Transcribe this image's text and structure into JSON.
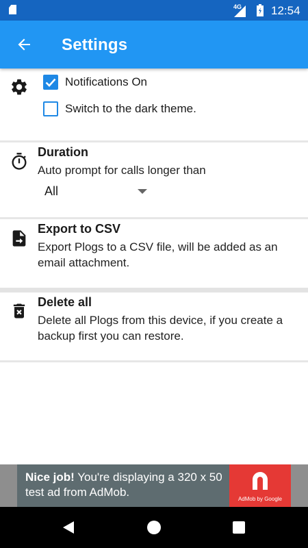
{
  "status_bar": {
    "network": "4G",
    "time": "12:54"
  },
  "app_bar": {
    "title": "Settings"
  },
  "theme_section": {
    "notifications": {
      "label": "Notifications On",
      "checked": true
    },
    "dark_theme": {
      "label": "Switch to the dark theme.",
      "checked": false
    }
  },
  "duration_section": {
    "title": "Duration",
    "description": "Auto prompt for calls longer than",
    "selected_value": "All"
  },
  "export_section": {
    "title": "Export to CSV",
    "description": "Export Plogs to a CSV file, will be added as an email attachment."
  },
  "delete_section": {
    "title": "Delete all",
    "description": "Delete all Plogs from this device, if you create a backup first you can restore."
  },
  "ad": {
    "headline": "Nice job!",
    "body": " You're displaying a 320 x 50 test ad from AdMob.",
    "logo_text": "AdMob by Google"
  },
  "colors": {
    "primary": "#2196f3",
    "primary_dark": "#1565c0",
    "accent": "#1e88e5",
    "ad_red": "#e53935"
  },
  "icons": [
    "sd-card-icon",
    "signal-icon",
    "battery-icon",
    "back-arrow-icon",
    "gear-icon",
    "timer-icon",
    "export-file-icon",
    "delete-icon",
    "admob-logo-icon"
  ]
}
